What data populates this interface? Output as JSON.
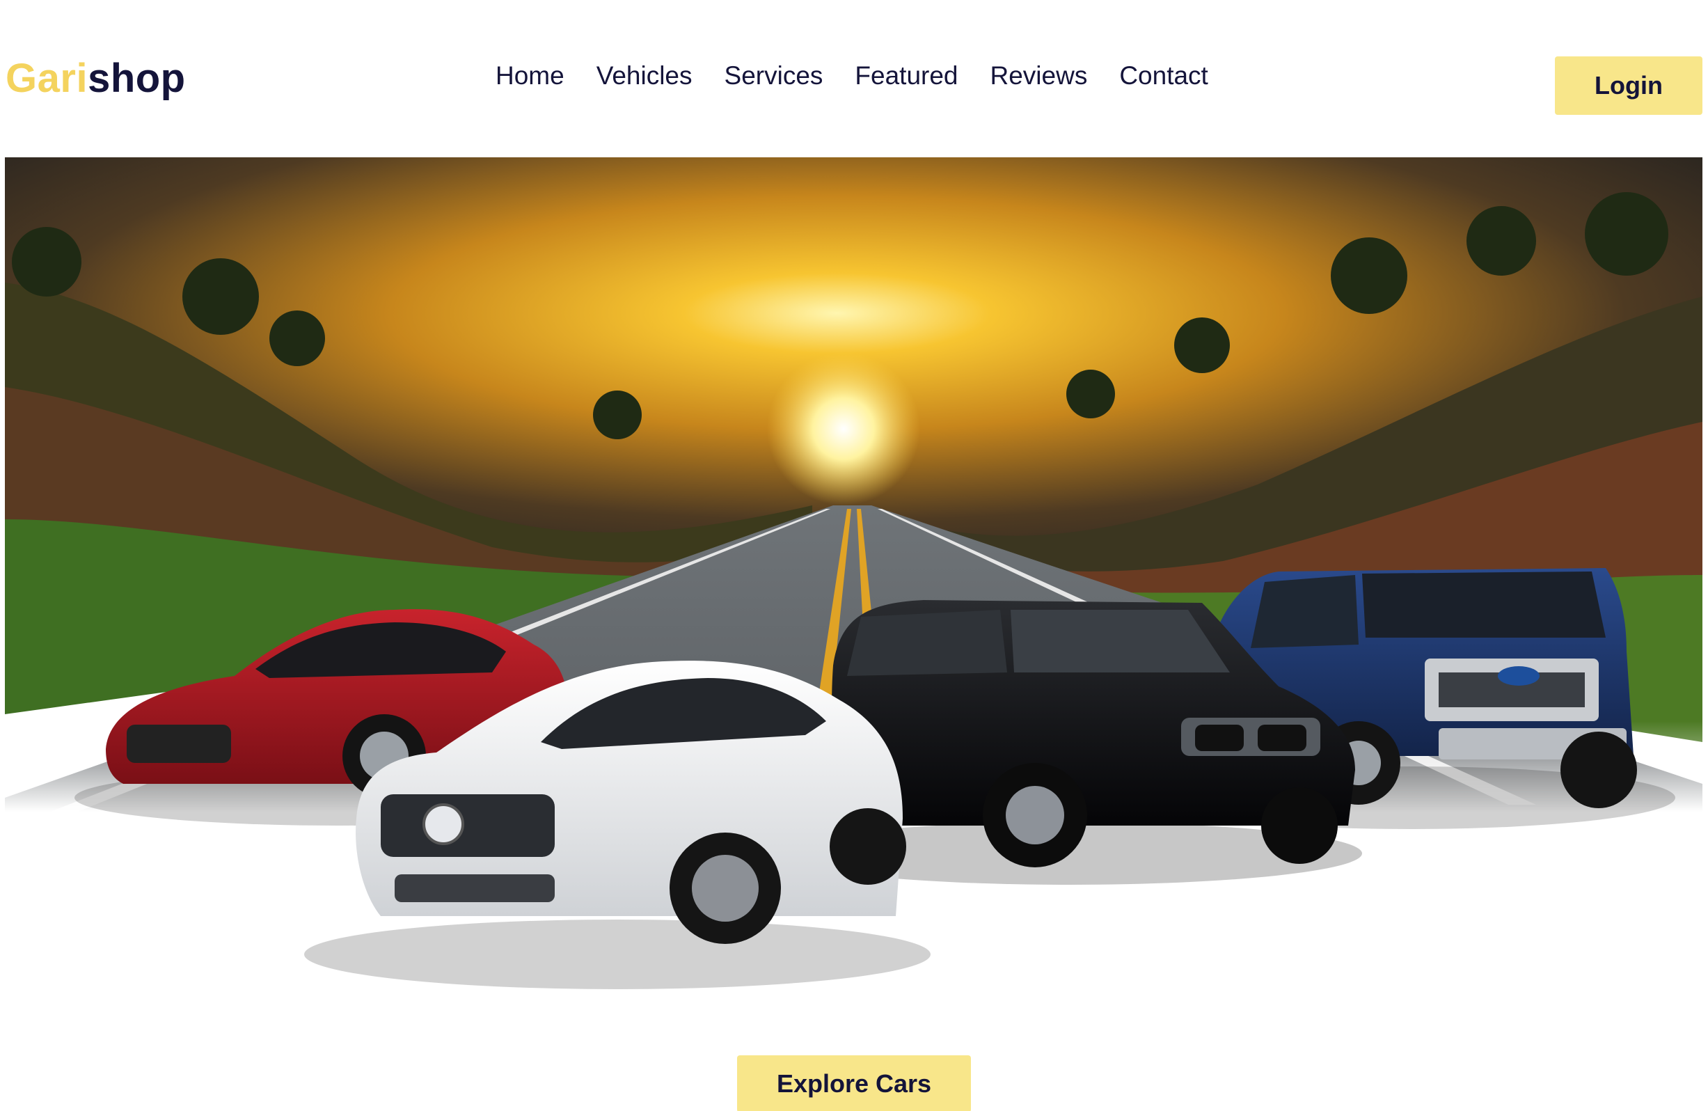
{
  "brand": {
    "logo_accent": "Gari",
    "logo_rest": "shop",
    "accent_color": "#f4d35e",
    "text_color": "#14143a"
  },
  "nav": {
    "items": [
      "Home",
      "Vehicles",
      "Services",
      "Featured",
      "Reviews",
      "Contact"
    ]
  },
  "header": {
    "login_label": "Login",
    "button_color": "#f8e68a"
  },
  "hero": {
    "image": "sunset-road-with-four-cars",
    "cars": [
      "red-sedan",
      "white-sedan",
      "black-suv",
      "blue-pickup-truck"
    ]
  },
  "cta": {
    "explore_label": "Explore Cars"
  }
}
